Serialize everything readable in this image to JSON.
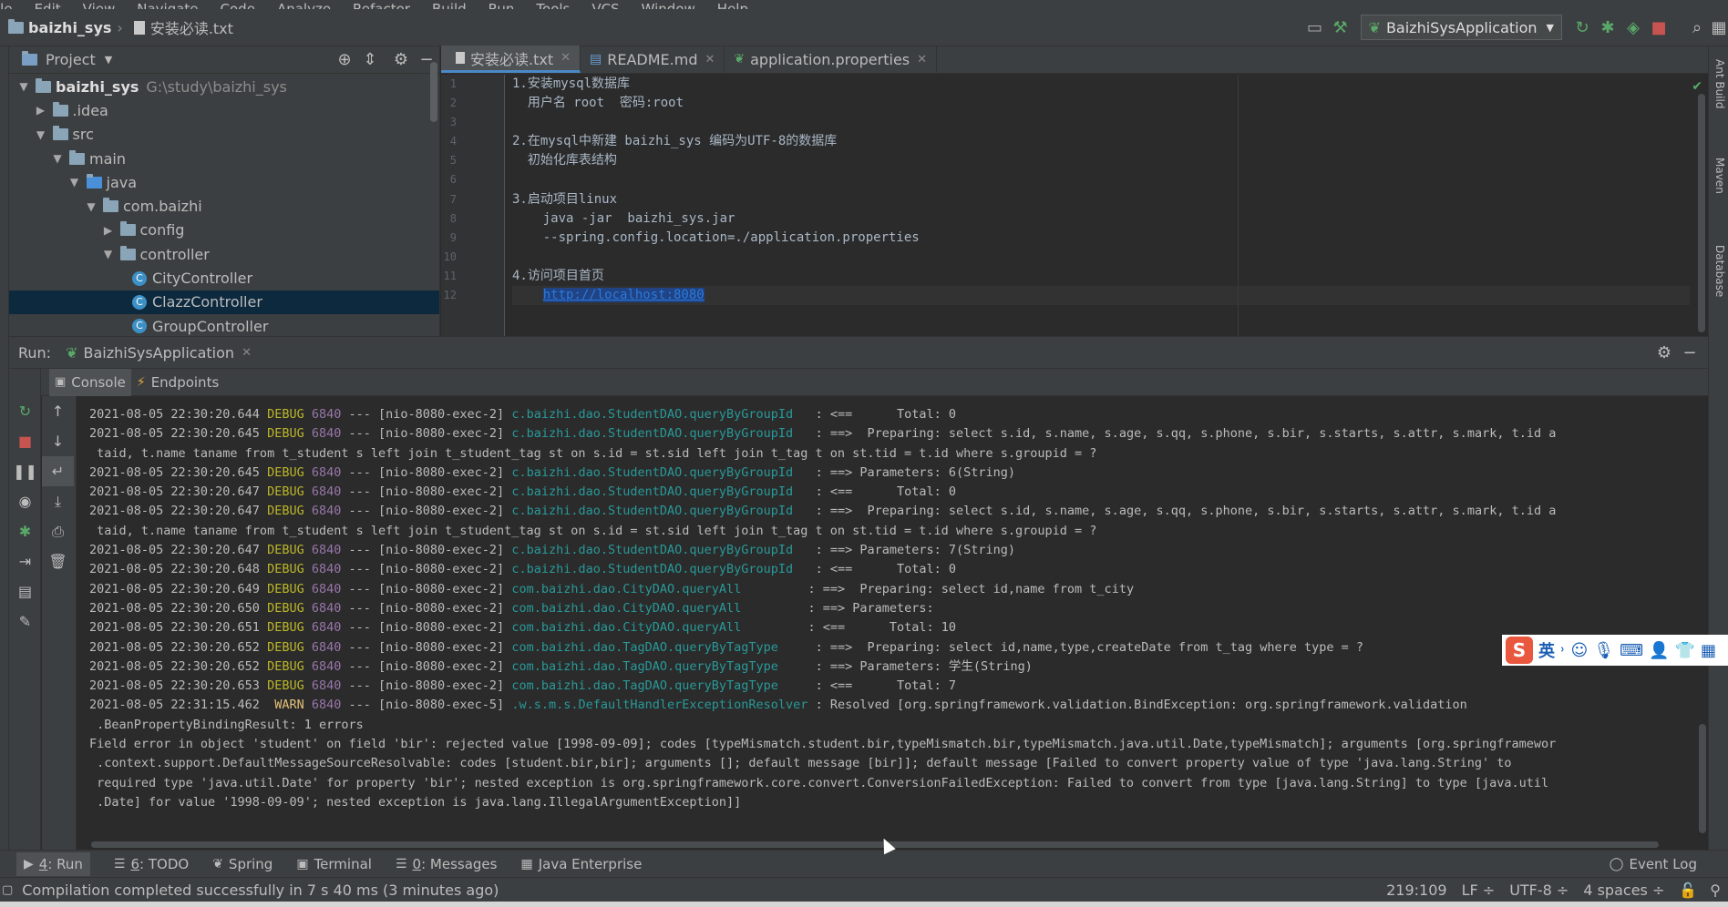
{
  "menu": [
    "ile",
    "Edit",
    "View",
    "Navigate",
    "Code",
    "Analyze",
    "Refactor",
    "Build",
    "Run",
    "Tools",
    "VCS",
    "Window",
    "Help"
  ],
  "breadcrumb": {
    "project": "baizhi_sys",
    "file": "安装必读.txt"
  },
  "run_config": "BaizhiSysApplication",
  "project_panel": {
    "title": "Project",
    "tree": [
      {
        "label": "baizhi_sys",
        "path": "G:\\study\\baizhi_sys",
        "depth": 0,
        "type": "root",
        "arrow": "▼"
      },
      {
        "label": ".idea",
        "depth": 1,
        "type": "folder",
        "arrow": "▶"
      },
      {
        "label": "src",
        "depth": 1,
        "type": "folder",
        "arrow": "▼"
      },
      {
        "label": "main",
        "depth": 2,
        "type": "folder",
        "arrow": "▼"
      },
      {
        "label": "java",
        "depth": 3,
        "type": "folder",
        "arrow": "▼"
      },
      {
        "label": "com.baizhi",
        "depth": 4,
        "type": "package",
        "arrow": "▼"
      },
      {
        "label": "config",
        "depth": 5,
        "type": "package",
        "arrow": "▶"
      },
      {
        "label": "controller",
        "depth": 5,
        "type": "package",
        "arrow": "▼"
      },
      {
        "label": "CityController",
        "depth": 6,
        "type": "class",
        "arrow": ""
      },
      {
        "label": "ClazzController",
        "depth": 6,
        "type": "class",
        "arrow": "",
        "selected": true
      },
      {
        "label": "GroupController",
        "depth": 6,
        "type": "class",
        "arrow": ""
      }
    ]
  },
  "editor": {
    "tabs": [
      {
        "label": "安装必读.txt",
        "active": true
      },
      {
        "label": "README.md",
        "active": false
      },
      {
        "label": "application.properties",
        "active": false
      }
    ],
    "lines": [
      {
        "n": "1",
        "text": "1.安装mysql数据库"
      },
      {
        "n": "2",
        "text": "  用户名 root  密码:root"
      },
      {
        "n": "3",
        "text": ""
      },
      {
        "n": "4",
        "text": "2.在mysql中新建 baizhi_sys 编码为UTF-8的数据库"
      },
      {
        "n": "5",
        "text": "  初始化库表结构"
      },
      {
        "n": "6",
        "text": ""
      },
      {
        "n": "7",
        "text": "3.启动项目linux"
      },
      {
        "n": "8",
        "text": "    java -jar  baizhi_sys.jar"
      },
      {
        "n": "9",
        "text": "    --spring.config.location=./application.properties"
      },
      {
        "n": "10",
        "text": ""
      },
      {
        "n": "11",
        "text": "4.访问项目首页"
      },
      {
        "n": "12",
        "text": "    ",
        "link": "http://localhost:8080"
      }
    ]
  },
  "run_panel": {
    "label": "Run:",
    "tab": "BaizhiSysApplication",
    "console_tab": "Console",
    "endpoints_tab": "Endpoints"
  },
  "console": [
    {
      "ts": "2021-08-05 22:30:20.644",
      "level": "DEBUG",
      "pid": "6840",
      "thread": "[nio-8080-exec-2]",
      "logger": "c.baizhi.dao.StudentDAO.queryByGroupId  ",
      "msg": ": <==      Total: 0"
    },
    {
      "ts": "2021-08-05 22:30:20.645",
      "level": "DEBUG",
      "pid": "6840",
      "thread": "[nio-8080-exec-2]",
      "logger": "c.baizhi.dao.StudentDAO.queryByGroupId  ",
      "msg": ": ==>  Preparing: select s.id, s.name, s.age, s.qq, s.phone, s.bir, s.starts, s.attr, s.mark, t.id a"
    },
    {
      "raw": " taid, t.name taname from t_student s left join t_student_tag st on s.id = st.sid left join t_tag t on st.tid = t.id where s.groupid = ?"
    },
    {
      "ts": "2021-08-05 22:30:20.645",
      "level": "DEBUG",
      "pid": "6840",
      "thread": "[nio-8080-exec-2]",
      "logger": "c.baizhi.dao.StudentDAO.queryByGroupId  ",
      "msg": ": ==> Parameters: 6(String)"
    },
    {
      "ts": "2021-08-05 22:30:20.647",
      "level": "DEBUG",
      "pid": "6840",
      "thread": "[nio-8080-exec-2]",
      "logger": "c.baizhi.dao.StudentDAO.queryByGroupId  ",
      "msg": ": <==      Total: 0"
    },
    {
      "ts": "2021-08-05 22:30:20.647",
      "level": "DEBUG",
      "pid": "6840",
      "thread": "[nio-8080-exec-2]",
      "logger": "c.baizhi.dao.StudentDAO.queryByGroupId  ",
      "msg": ": ==>  Preparing: select s.id, s.name, s.age, s.qq, s.phone, s.bir, s.starts, s.attr, s.mark, t.id a"
    },
    {
      "raw": " taid, t.name taname from t_student s left join t_student_tag st on s.id = st.sid left join t_tag t on st.tid = t.id where s.groupid = ?"
    },
    {
      "ts": "2021-08-05 22:30:20.647",
      "level": "DEBUG",
      "pid": "6840",
      "thread": "[nio-8080-exec-2]",
      "logger": "c.baizhi.dao.StudentDAO.queryByGroupId  ",
      "msg": ": ==> Parameters: 7(String)"
    },
    {
      "ts": "2021-08-05 22:30:20.648",
      "level": "DEBUG",
      "pid": "6840",
      "thread": "[nio-8080-exec-2]",
      "logger": "c.baizhi.dao.StudentDAO.queryByGroupId  ",
      "msg": ": <==      Total: 0"
    },
    {
      "ts": "2021-08-05 22:30:20.649",
      "level": "DEBUG",
      "pid": "6840",
      "thread": "[nio-8080-exec-2]",
      "logger": "com.baizhi.dao.CityDAO.queryAll        ",
      "msg": ": ==>  Preparing: select id,name from t_city"
    },
    {
      "ts": "2021-08-05 22:30:20.650",
      "level": "DEBUG",
      "pid": "6840",
      "thread": "[nio-8080-exec-2]",
      "logger": "com.baizhi.dao.CityDAO.queryAll        ",
      "msg": ": ==> Parameters: "
    },
    {
      "ts": "2021-08-05 22:30:20.651",
      "level": "DEBUG",
      "pid": "6840",
      "thread": "[nio-8080-exec-2]",
      "logger": "com.baizhi.dao.CityDAO.queryAll        ",
      "msg": ": <==      Total: 10"
    },
    {
      "ts": "2021-08-05 22:30:20.652",
      "level": "DEBUG",
      "pid": "6840",
      "thread": "[nio-8080-exec-2]",
      "logger": "com.baizhi.dao.TagDAO.queryByTagType    ",
      "msg": ": ==>  Preparing: select id,name,type,createDate from t_tag where type = ?"
    },
    {
      "ts": "2021-08-05 22:30:20.652",
      "level": "DEBUG",
      "pid": "6840",
      "thread": "[nio-8080-exec-2]",
      "logger": "com.baizhi.dao.TagDAO.queryByTagType    ",
      "msg": ": ==> Parameters: 学生(String)"
    },
    {
      "ts": "2021-08-05 22:30:20.653",
      "level": "DEBUG",
      "pid": "6840",
      "thread": "[nio-8080-exec-2]",
      "logger": "com.baizhi.dao.TagDAO.queryByTagType    ",
      "msg": ": <==      Total: 7"
    },
    {
      "ts": "2021-08-05 22:31:15.462",
      "level": " WARN",
      "pid": "6840",
      "thread": "[nio-8080-exec-5]",
      "logger": ".w.s.m.s.DefaultHandlerExceptionResolver",
      "msg": ": Resolved [org.springframework.validation.BindException: org.springframework.validation"
    },
    {
      "raw": " .BeanPropertyBindingResult: 1 errors"
    },
    {
      "raw": "Field error in object 'student' on field 'bir': rejected value [1998-09-09]; codes [typeMismatch.student.bir,typeMismatch.bir,typeMismatch.java.util.Date,typeMismatch]; arguments [org.springframewor"
    },
    {
      "raw": " .context.support.DefaultMessageSourceResolvable: codes [student.bir,bir]; arguments []; default message [bir]]; default message [Failed to convert property value of type 'java.lang.String' to"
    },
    {
      "raw": " required type 'java.util.Date' for property 'bir'; nested exception is org.springframework.core.convert.ConversionFailedException: Failed to convert from type [java.lang.String] to type [java.util"
    },
    {
      "raw": " .Date] for value '1998-09-09'; nested exception is java.lang.IllegalArgumentException]]"
    }
  ],
  "bottom_tabs": [
    {
      "num": "4",
      "label": ": Run",
      "icon": "▶"
    },
    {
      "num": "6",
      "label": ": TODO",
      "icon": "☰"
    },
    {
      "num": "",
      "label": "Spring",
      "icon": "❦"
    },
    {
      "num": "",
      "label": "Terminal",
      "icon": "▣"
    },
    {
      "num": "0",
      "label": ": Messages",
      "icon": "☰"
    },
    {
      "num": "",
      "label": "Java Enterprise",
      "icon": "▦"
    }
  ],
  "event_log": "Event Log",
  "right_tools": [
    "Ant Build",
    "Maven",
    "Database"
  ],
  "status": {
    "message": "Compilation completed successfully in 7 s 40 ms (3 minutes ago)",
    "position": "219:109",
    "line_sep": "LF ÷",
    "encoding": "UTF-8 ÷",
    "indent": "4 spaces ÷"
  },
  "ime": {
    "logo": "S",
    "mode": "英"
  },
  "colors": {
    "accent": "#4a88c7",
    "selection": "#0d293e",
    "debug": "#bbb529",
    "logger": "#299999"
  }
}
